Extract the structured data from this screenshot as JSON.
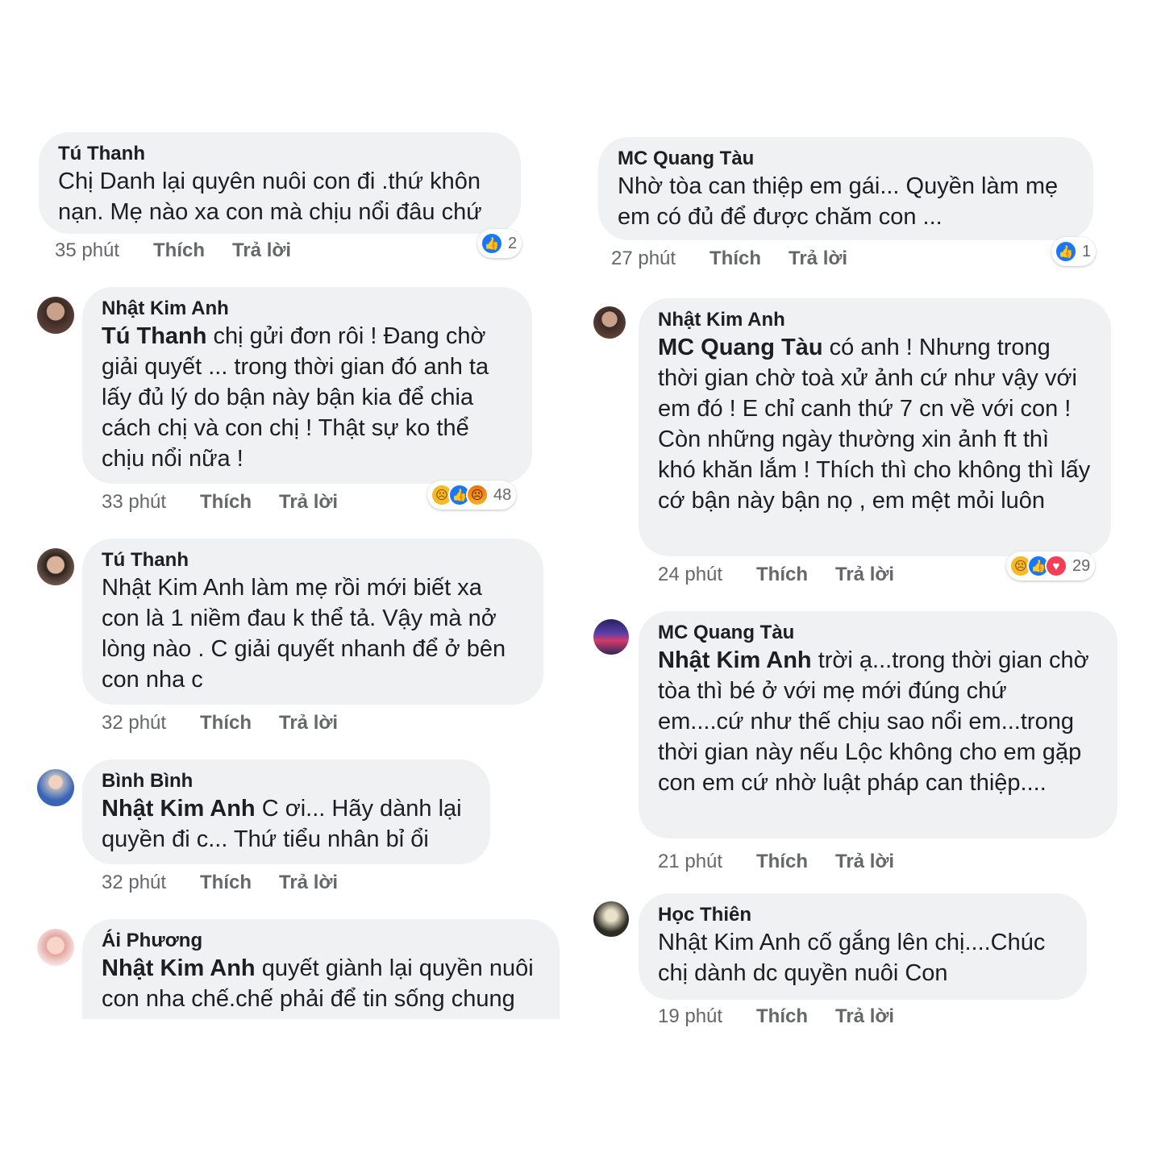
{
  "reactions_labels": {
    "like_icon": "like-reaction-icon",
    "sad_icon": "sad-reaction-icon",
    "angry_icon": "angry-reaction-icon",
    "love_icon": "love-reaction-icon"
  },
  "colors": {
    "bubble": "#f0f1f3",
    "meta_text": "#65676b",
    "like_blue": "#1877f2",
    "love_red": "#f33e58",
    "sad_yellow": "#f7b928"
  },
  "left": [
    {
      "name": "Tú Thanh",
      "mention": "",
      "text": "Chị Danh lại quyên nuôi con đi .thứ khôn nạn. Mẹ nào xa con mà chịu nổi đâu chứ",
      "time": "35 phút",
      "like": "Thích",
      "reply": "Trả lời",
      "reaction_count": "2"
    },
    {
      "name": "Nhật Kim Anh",
      "mention": "Tú Thanh",
      "text": " chị gửi đơn rôi ! Đang chờ giải quyết ... trong thời gian đó anh ta lấy đủ lý do bận này bận kia để chia cách chị và con chị ! Thật sự ko thể chịu nổi nữa !",
      "time": "33 phút",
      "like": "Thích",
      "reply": "Trả lời",
      "reaction_count": "48"
    },
    {
      "name": "Tú Thanh",
      "mention": "",
      "text": "Nhật Kim Anh làm mẹ rồi mới biết xa con là 1 niềm đau k thể tả. Vậy mà nở lòng nào . C giải quyết nhanh để ở bên con nha c",
      "time": "32 phút",
      "like": "Thích",
      "reply": "Trả lời"
    },
    {
      "name": "Bình Bình",
      "mention": "Nhật Kim Anh",
      "text": " C ơi... Hãy dành lại quyền đi c... Thứ tiểu nhân bỉ ổi",
      "time": "32 phút",
      "like": "Thích",
      "reply": "Trả lời"
    },
    {
      "name": "Ái Phương",
      "mention": "Nhật Kim Anh",
      "text": " quyết giành lại quyền nuôi con nha chế.chế phải để tin sống chung"
    }
  ],
  "right": [
    {
      "name": "MC Quang Tàu",
      "mention": "",
      "text": "Nhờ tòa can thiệp em gái... Quyền làm mẹ em có đủ để được chăm con ...",
      "time": "27 phút",
      "like": "Thích",
      "reply": "Trả lời",
      "reaction_count": "1"
    },
    {
      "name": "Nhật Kim Anh",
      "mention": "MC Quang Tàu",
      "text": " có anh ! Nhưng trong thời gian chờ toà xử ảnh cứ như vậy với em đó ! E chỉ canh thứ 7 cn về với con ! Còn những ngày thường xin ảnh ft thì khó khăn lắm ! Thích thì cho không thì lấy cớ bận này bận nọ , em mệt mỏi luôn",
      "time": "24 phút",
      "like": "Thích",
      "reply": "Trả lời",
      "reaction_count": "29"
    },
    {
      "name": "MC Quang Tàu",
      "mention": "Nhật Kim Anh",
      "text": " trời ạ...trong thời gian chờ tòa thì bé ở với mẹ mới đúng chứ em....cứ như thế chịu sao nổi em...trong thời gian này nếu Lộc không cho em gặp con em cứ nhờ luật pháp can thiệp....",
      "time": "21 phút",
      "like": "Thích",
      "reply": "Trả lời"
    },
    {
      "name": "Học Thiên",
      "mention": "",
      "text": "Nhật Kim Anh cố gắng lên chị....Chúc chị dành dc quyền nuôi Con",
      "time": "19 phút",
      "like": "Thích",
      "reply": "Trả lời"
    }
  ]
}
